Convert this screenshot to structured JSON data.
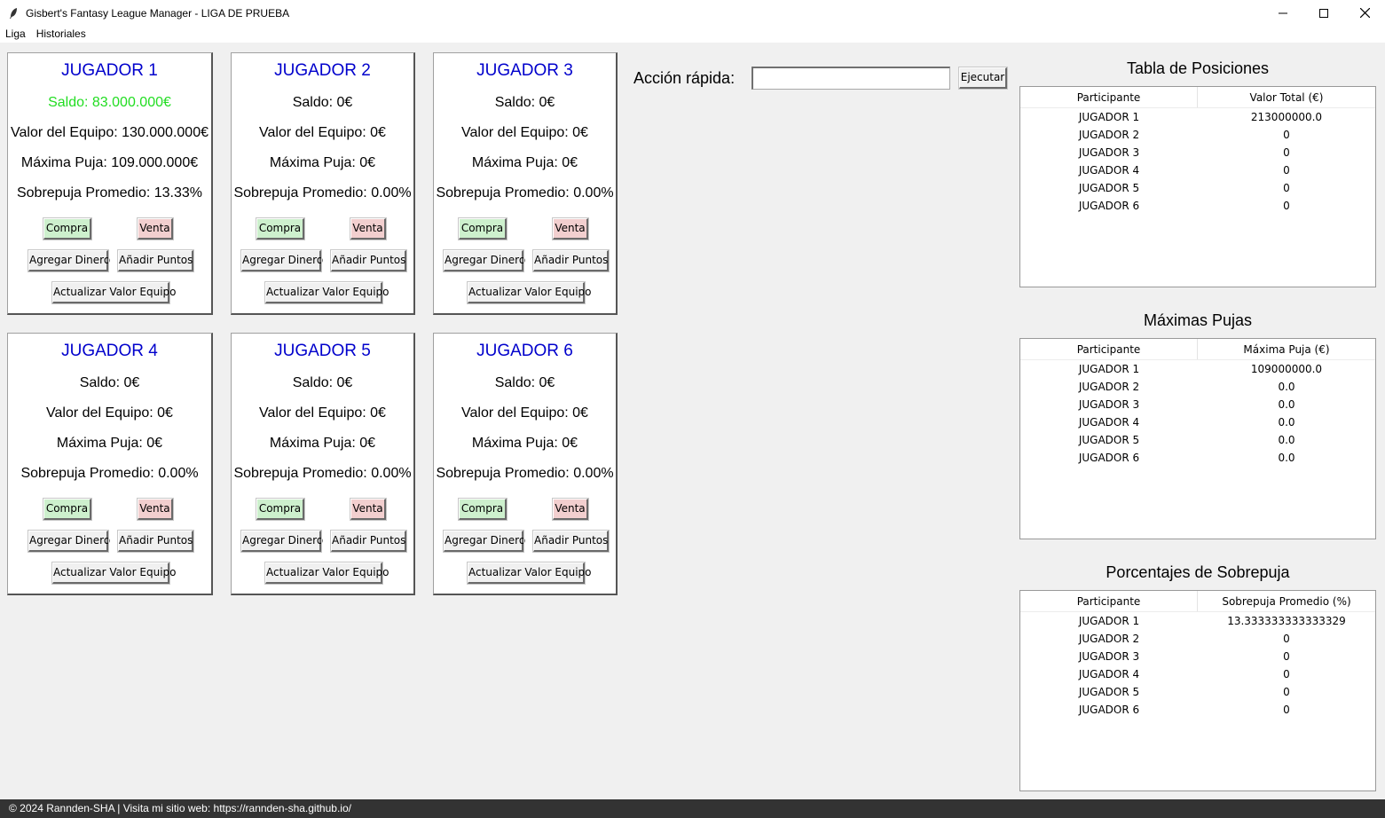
{
  "window": {
    "title": "Gisbert's Fantasy League Manager - LIGA DE PRUEBA",
    "controls": [
      "minimize-icon",
      "maximize-icon",
      "close-icon"
    ]
  },
  "menu": [
    "Liga",
    "Historiales"
  ],
  "colors": {
    "player_name": "#0000cc",
    "positive_balance": "#22dd22",
    "buy": "#cdf0cd",
    "sell": "#f2cfcf",
    "footer": "#333333"
  },
  "buttons": {
    "buy": "Compra",
    "sell": "Venta",
    "add_money": "Agregar Dinero",
    "add_points": "Añadir Puntos",
    "update_value": "Actualizar Valor Equipo"
  },
  "players": [
    {
      "name": "JUGADOR 1",
      "saldo": "Saldo: 83.000.000€",
      "valor": "Valor del Equipo: 130.000.000€",
      "puja": "Máxima Puja: 109.000.000€",
      "sobrepuja": "Sobrepuja Promedio: 13.33%"
    },
    {
      "name": "JUGADOR 2",
      "saldo": "Saldo: 0€",
      "valor": "Valor del Equipo: 0€",
      "puja": "Máxima Puja: 0€",
      "sobrepuja": "Sobrepuja Promedio: 0.00%"
    },
    {
      "name": "JUGADOR 3",
      "saldo": "Saldo: 0€",
      "valor": "Valor del Equipo: 0€",
      "puja": "Máxima Puja: 0€",
      "sobrepuja": "Sobrepuja Promedio: 0.00%"
    },
    {
      "name": "JUGADOR 4",
      "saldo": "Saldo: 0€",
      "valor": "Valor del Equipo: 0€",
      "puja": "Máxima Puja: 0€",
      "sobrepuja": "Sobrepuja Promedio: 0.00%"
    },
    {
      "name": "JUGADOR 5",
      "saldo": "Saldo: 0€",
      "valor": "Valor del Equipo: 0€",
      "puja": "Máxima Puja: 0€",
      "sobrepuja": "Sobrepuja Promedio: 0.00%"
    },
    {
      "name": "JUGADOR 6",
      "saldo": "Saldo: 0€",
      "valor": "Valor del Equipo: 0€",
      "puja": "Máxima Puja: 0€",
      "sobrepuja": "Sobrepuja Promedio: 0.00%"
    }
  ],
  "quick_action": {
    "label": "Acción rápida:",
    "value": "",
    "button": "Ejecutar"
  },
  "tables": [
    {
      "title": "Tabla de Posiciones",
      "columns": [
        "Participante",
        "Valor Total (€)"
      ],
      "rows": [
        [
          "JUGADOR 1",
          "213000000.0"
        ],
        [
          "JUGADOR 2",
          "0"
        ],
        [
          "JUGADOR 3",
          "0"
        ],
        [
          "JUGADOR 4",
          "0"
        ],
        [
          "JUGADOR 5",
          "0"
        ],
        [
          "JUGADOR 6",
          "0"
        ]
      ]
    },
    {
      "title": "Máximas Pujas",
      "columns": [
        "Participante",
        "Máxima Puja (€)"
      ],
      "rows": [
        [
          "JUGADOR 1",
          "109000000.0"
        ],
        [
          "JUGADOR 2",
          "0.0"
        ],
        [
          "JUGADOR 3",
          "0.0"
        ],
        [
          "JUGADOR 4",
          "0.0"
        ],
        [
          "JUGADOR 5",
          "0.0"
        ],
        [
          "JUGADOR 6",
          "0.0"
        ]
      ]
    },
    {
      "title": "Porcentajes de Sobrepuja",
      "columns": [
        "Participante",
        "Sobrepuja Promedio (%)"
      ],
      "rows": [
        [
          "JUGADOR 1",
          "13.333333333333329"
        ],
        [
          "JUGADOR 2",
          "0"
        ],
        [
          "JUGADOR 3",
          "0"
        ],
        [
          "JUGADOR 4",
          "0"
        ],
        [
          "JUGADOR 5",
          "0"
        ],
        [
          "JUGADOR 6",
          "0"
        ]
      ]
    }
  ],
  "footer": "© 2024 Rannden-SHA | Visita mi sitio web: https://rannden-sha.github.io/"
}
